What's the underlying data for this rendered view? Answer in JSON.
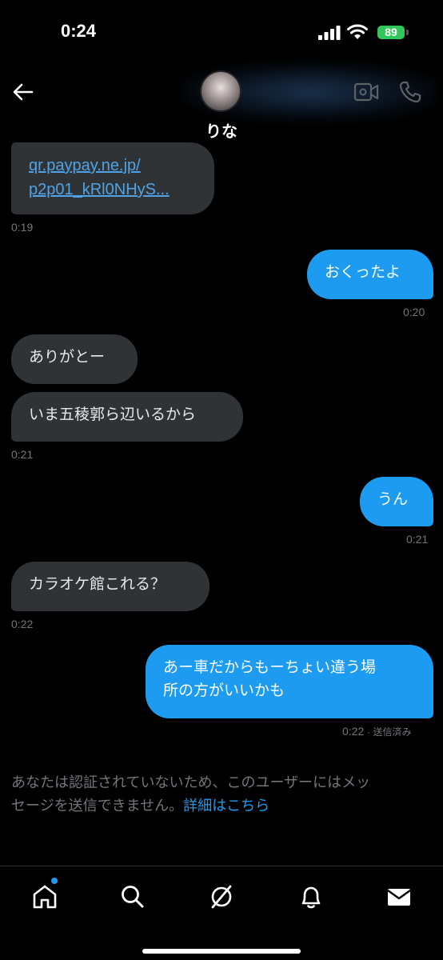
{
  "status": {
    "time": "0:24",
    "battery": "89"
  },
  "header": {
    "contact_name": "りな"
  },
  "messages": [
    {
      "link_line1": "qr.paypay.ne.jp/",
      "link_line2": "p2p01_kRl0NHyS..."
    },
    {
      "time": "0:19"
    },
    {
      "text": "おくったよ",
      "time": "0:20"
    },
    {
      "text": "ありがとー"
    },
    {
      "text": "いま五稜郭ら辺いるから",
      "time": "0:21"
    },
    {
      "text": "うん",
      "time": "0:21"
    },
    {
      "text": "カラオケ館これる？",
      "time": "0:22"
    },
    {
      "text_line1": "あー車だからもーちょい違う場",
      "text_line2": "所の方がいいかも",
      "time": "0:22",
      "status": "· 送信済み"
    }
  ],
  "notice": {
    "line1": "あなたは認証されていないため、このユーザーにはメッ",
    "line2": "セージを送信できません。",
    "link": "詳細はこちら"
  },
  "nav": {
    "icons": [
      "home-icon",
      "search-icon",
      "grok-icon",
      "bell-icon",
      "mail-icon"
    ]
  },
  "colors": {
    "accent": "#1d9bf0",
    "incoming_bubble": "#2f3336",
    "battery": "#32c75a"
  }
}
